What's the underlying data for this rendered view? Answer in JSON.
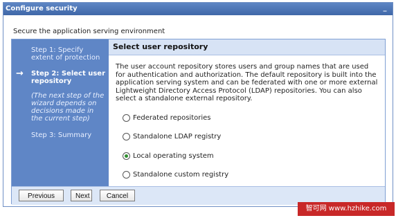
{
  "window": {
    "title": "Configure security",
    "minimize_label": "_"
  },
  "subtitle": "Secure the application serving environment",
  "steps": [
    {
      "label": "Step  1:  Specify extent of protection"
    },
    {
      "label": "Step  2:  Select user repository"
    },
    {
      "label": "Step  3:  Summary"
    }
  ],
  "current_step_marker": "→",
  "step_note": "(The next step of the wizard depends on decisions made in the current step)",
  "content": {
    "header": "Select user repository",
    "description": "The user account repository stores users and group names that are used for authentication and authorization. The default repository is built into the application serving system and can be federated with one or more external Lightweight Directory Access Protocol (LDAP) repositories. You can also select a standalone external repository.",
    "options": [
      {
        "label": "Federated repositories",
        "checked": false
      },
      {
        "label": "Standalone LDAP registry",
        "checked": false
      },
      {
        "label": "Local operating system",
        "checked": true
      },
      {
        "label": "Standalone custom registry",
        "checked": false
      }
    ]
  },
  "buttons": {
    "previous": "Previous",
    "next": "Next",
    "cancel": "Cancel"
  },
  "watermark": "智可网 www.hzhike.com",
  "colors": {
    "title_bar": "#3f67a8",
    "step_panel": "#5f86c6",
    "content_header": "#d7e3f5",
    "watermark": "#c82828"
  }
}
